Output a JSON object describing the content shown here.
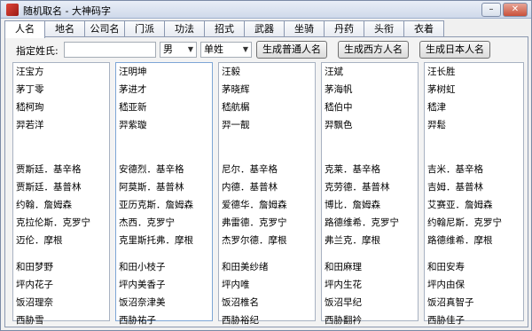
{
  "window": {
    "title": "随机取名 - 大神码字",
    "minimize": "–",
    "close": "✕"
  },
  "tabs": [
    "人名",
    "地名",
    "公司名",
    "门派",
    "功法",
    "招式",
    "武器",
    "坐骑",
    "丹药",
    "头衔",
    "衣着"
  ],
  "form": {
    "surname_label": "指定姓氏:",
    "surname_value": "",
    "gender": "男",
    "surname_type": "单姓",
    "btn_normal": "生成普通人名",
    "btn_western": "生成西方人名",
    "btn_japanese": "生成日本人名"
  },
  "columns": [
    {
      "chinese": [
        "汪宝方",
        "茅丁零",
        "嵇柯珣",
        "羿若洋"
      ],
      "western": [
        "贾斯廷．基辛格",
        "贾斯廷．基普林",
        "约翰．詹姆森",
        "克拉伦斯．克罗宁",
        "迈伦．摩根"
      ],
      "japanese": [
        "和田梦野",
        "坪内花子",
        "饭沼理奈",
        "西胁雪"
      ]
    },
    {
      "chinese": [
        "汪明坤",
        "茅进才",
        "嵇亚新",
        "羿紫璇"
      ],
      "western": [
        "安德烈．基辛格",
        "阿莫斯．基普林",
        "亚历克斯．詹姆森",
        "杰西．克罗宁",
        "克里斯托弗．摩根"
      ],
      "japanese": [
        "和田小枝子",
        "坪内美香子",
        "饭沼奈津美",
        "西胁祐子"
      ]
    },
    {
      "chinese": [
        "汪毅",
        "茅晓辉",
        "嵇航榍",
        "羿一靓"
      ],
      "western": [
        "尼尔．基辛格",
        "内德．基普林",
        "爱德华．詹姆森",
        "弗雷德．克罗宁",
        "杰罗尔德．摩根"
      ],
      "japanese": [
        "和田美纱绪",
        "坪内唯",
        "饭沼椎名",
        "西胁裕纪"
      ]
    },
    {
      "chinese": [
        "汪斌",
        "茅海帆",
        "嵇伯中",
        "羿飘色"
      ],
      "western": [
        "克莱．基辛格",
        "克劳德．基普林",
        "博比．詹姆森",
        "路德维希．克罗宁",
        "弗兰克．摩根"
      ],
      "japanese": [
        "和田麻理",
        "坪内生花",
        "饭沼早纪",
        "西胁翻衿"
      ]
    },
    {
      "chinese": [
        "汪长胜",
        "茅树虹",
        "嵇津",
        "羿鬆"
      ],
      "western": [
        "吉米．基辛格",
        "吉姆．基普林",
        "艾赛亚．詹姆森",
        "约翰尼斯．克罗宁",
        "路德维希．摩根"
      ],
      "japanese": [
        "和田安寿",
        "坪内由保",
        "饭沼真智子",
        "西胁佳子"
      ]
    }
  ]
}
